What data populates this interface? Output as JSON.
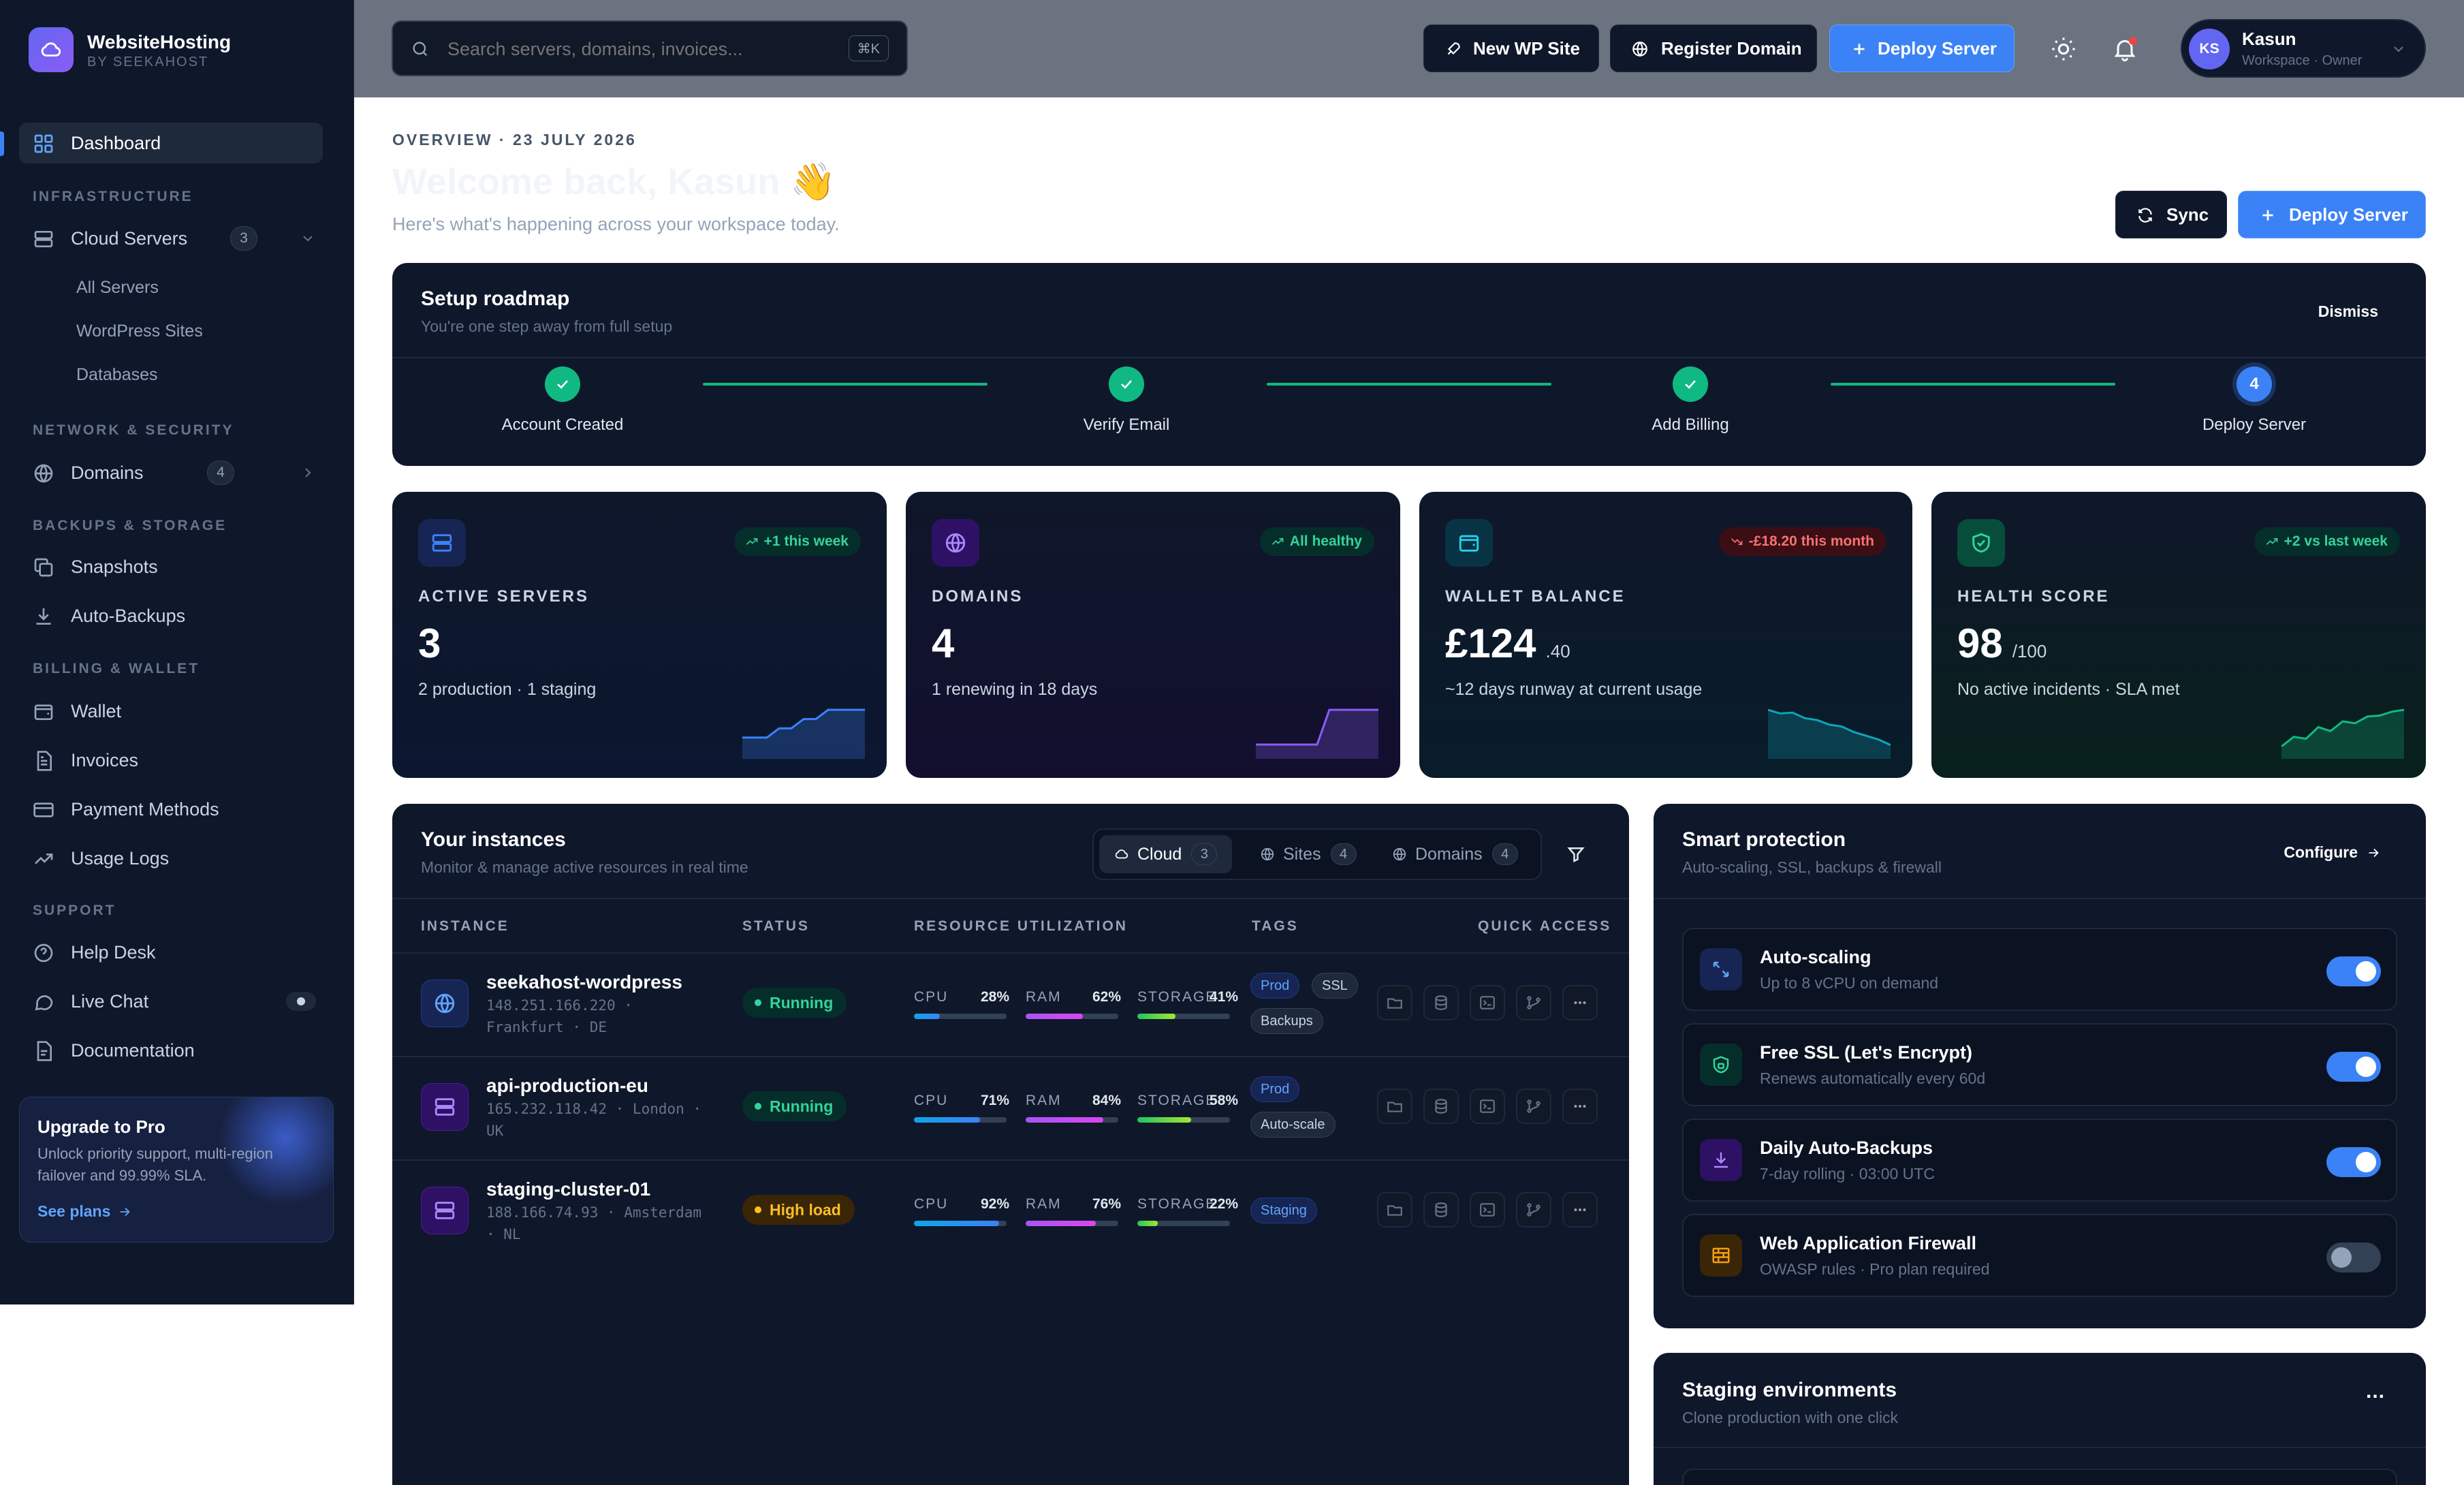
{
  "brand": {
    "name": "WebsiteHosting",
    "sub": "BY SEEKAHOST"
  },
  "nav": {
    "dashboard": "Dashboard",
    "sections": {
      "infra": "INFRASTRUCTURE",
      "network": "NETWORK & SECURITY",
      "backups": "BACKUPS & STORAGE",
      "billing": "BILLING & WALLET",
      "support": "SUPPORT"
    },
    "cloud_servers": {
      "label": "Cloud Servers",
      "count": "3"
    },
    "sub_items": [
      "All Servers",
      "WordPress Sites",
      "Databases"
    ],
    "domains": {
      "label": "Domains",
      "count": "4"
    },
    "snapshots": "Snapshots",
    "auto_backups": "Auto-Backups",
    "wallet": "Wallet",
    "invoices": "Invoices",
    "payment_methods": "Payment Methods",
    "usage_logs": "Usage Logs",
    "help_desk": "Help Desk",
    "live_chat": "Live Chat",
    "documentation": "Documentation"
  },
  "upgrade": {
    "title": "Upgrade to Pro",
    "text1": "Unlock priority support, multi-region",
    "text2": "failover and 99.99% SLA.",
    "link": "See plans"
  },
  "header": {
    "search_placeholder": "Search servers, domains, invoices...",
    "shortcut": "⌘K",
    "new_wp": "New WP Site",
    "register_domain": "Register Domain",
    "deploy_server": "Deploy Server",
    "user": {
      "initials": "KS",
      "name": "Kasun",
      "role": "Workspace · Owner"
    }
  },
  "overview": {
    "overline": "OVERVIEW · 23 JULY 2026",
    "welcome": "Welcome back, Kasun",
    "wave": "👋",
    "subtitle": "Here's what's happening across your workspace today.",
    "sync": "Sync",
    "deploy": "Deploy Server"
  },
  "roadmap": {
    "title": "Setup roadmap",
    "subtitle": "You're one step away from full setup",
    "dismiss": "Dismiss",
    "steps": [
      {
        "label": "Account Created",
        "done": true
      },
      {
        "label": "Verify Email",
        "done": true
      },
      {
        "label": "Add Billing",
        "done": true
      },
      {
        "label": "Deploy Server",
        "done": false,
        "num": "4"
      }
    ]
  },
  "stats": [
    {
      "label": "ACTIVE SERVERS",
      "value": "3",
      "unit": "",
      "desc": "2 production · 1 staging",
      "pill": "+1 this week",
      "trend": "up",
      "color": "#3b82f6",
      "spark": [
        2,
        2,
        2,
        3,
        3,
        4,
        4,
        5,
        5,
        5,
        5
      ]
    },
    {
      "label": "DOMAINS",
      "value": "4",
      "unit": "",
      "desc": "1 renewing in 18 days",
      "pill": "All healthy",
      "trend": "up",
      "color": "#8b5cf6",
      "spark": [
        1,
        1,
        1,
        1,
        1,
        1,
        4,
        4,
        4,
        4,
        4
      ]
    },
    {
      "label": "WALLET BALANCE",
      "value": "£124",
      "unit": ".40",
      "desc": "~12 days runway at current usage",
      "pill": "-£18.20 this month",
      "trend": "down",
      "color": "#0ea5b7",
      "spark": [
        5,
        4.6,
        4.7,
        4.1,
        3.9,
        3.4,
        3.2,
        2.6,
        2.2,
        1.8,
        1.2
      ]
    },
    {
      "label": "HEALTH SCORE",
      "value": "98",
      "unit": "/100",
      "desc": "No active incidents · SLA met",
      "pill": "+2 vs last week",
      "trend": "up",
      "color": "#10b981",
      "spark": [
        1,
        2,
        1.8,
        3,
        2.6,
        3.6,
        3.4,
        4.1,
        4.2,
        4.6,
        4.8
      ]
    }
  ],
  "instances": {
    "title": "Your instances",
    "subtitle": "Monitor & manage active resources in real time",
    "tabs": [
      {
        "label": "Cloud",
        "count": "3"
      },
      {
        "label": "Sites",
        "count": "4"
      },
      {
        "label": "Domains",
        "count": "4"
      }
    ],
    "columns": [
      "INSTANCE",
      "STATUS",
      "RESOURCE UTILIZATION",
      "TAGS",
      "QUICK ACCESS"
    ],
    "metric_labels": [
      "CPU",
      "RAM",
      "STORAGE"
    ],
    "rows": [
      {
        "name": "seekahost-wordpress",
        "addr1": "148.251.166.220 ·",
        "addr2": "Frankfurt · DE",
        "status": "Running",
        "cpu": "28%",
        "ram": "62%",
        "storage": "41%",
        "cpu_v": 28,
        "ram_v": 62,
        "storage_v": 41,
        "tags": [
          "Prod",
          "SSL",
          "Backups"
        ]
      },
      {
        "name": "api-production-eu",
        "addr1": "165.232.118.42 · London ·",
        "addr2": "UK",
        "status": "Running",
        "cpu": "71%",
        "ram": "84%",
        "storage": "58%",
        "cpu_v": 71,
        "ram_v": 84,
        "storage_v": 58,
        "tags": [
          "Prod",
          "Auto-scale"
        ]
      },
      {
        "name": "staging-cluster-01",
        "addr1": "188.166.74.93 · Amsterdam",
        "addr2": "· NL",
        "status": "High load",
        "cpu": "92%",
        "ram": "76%",
        "storage": "22%",
        "cpu_v": 92,
        "ram_v": 76,
        "storage_v": 22,
        "tags": [
          "Staging"
        ]
      }
    ]
  },
  "protection": {
    "title": "Smart protection",
    "subtitle": "Auto-scaling, SSL, backups & firewall",
    "configure": "Configure",
    "items": [
      {
        "title": "Auto-scaling",
        "sub": "Up to 8 vCPU on demand",
        "on": true
      },
      {
        "title": "Free SSL (Let's Encrypt)",
        "sub": "Renews automatically every 60d",
        "on": true
      },
      {
        "title": "Daily Auto-Backups",
        "sub": "7-day rolling · 03:00 UTC",
        "on": true
      },
      {
        "title": "Web Application Firewall",
        "sub": "OWASP rules · Pro plan required",
        "on": false
      }
    ]
  },
  "staging": {
    "title": "Staging environments",
    "subtitle": "Clone production with one click",
    "more": "..."
  },
  "colors": {
    "accent": "#3b82f6",
    "success": "#10b981",
    "warning": "#f59e0b",
    "danger": "#ef4444",
    "purple": "#8b5cf6"
  }
}
